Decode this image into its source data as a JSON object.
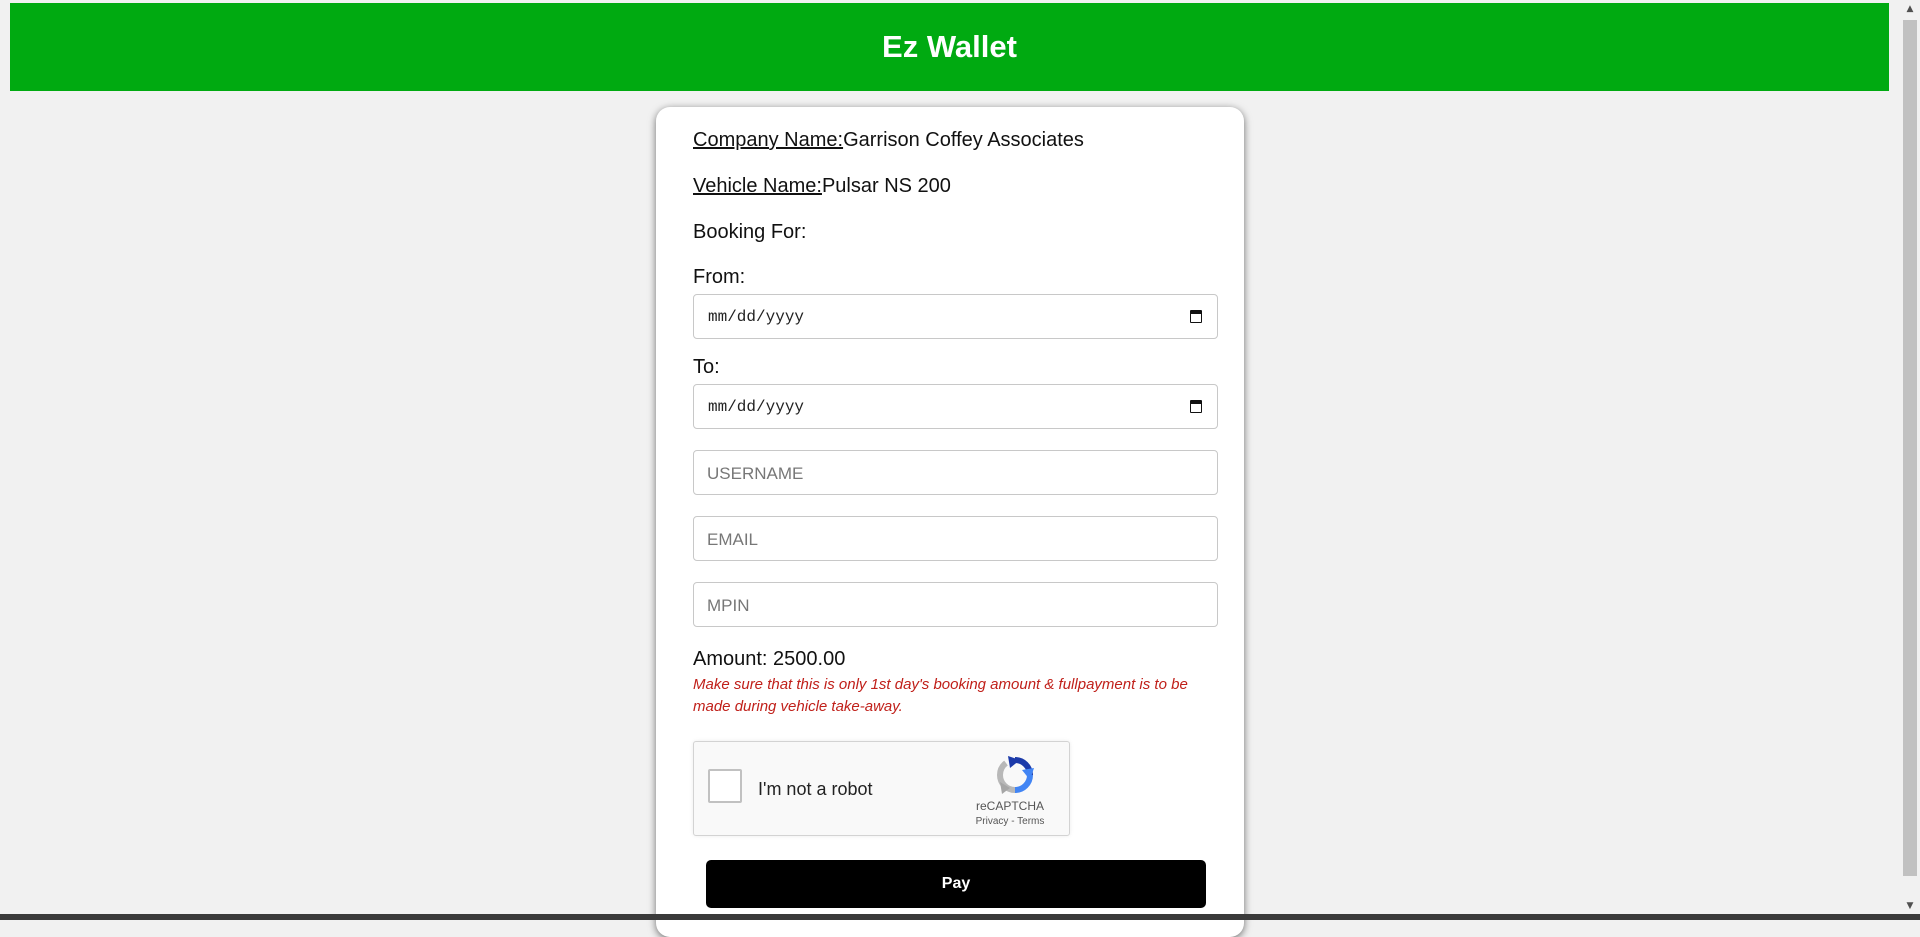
{
  "header": {
    "title": "Ez Wallet"
  },
  "booking": {
    "company_label": "Company Name:",
    "company_value": "Garrison Coffey Associates",
    "vehicle_label": "Vehicle Name:",
    "vehicle_value": "Pulsar NS 200",
    "booking_for_label": "Booking For:"
  },
  "form": {
    "from_label": "From:",
    "from_value": "mm/dd/yyyy",
    "to_label": "To:",
    "to_value": "mm/dd/yyyy",
    "username_placeholder": "USERNAME",
    "email_placeholder": "EMAIL",
    "mpin_placeholder": "MPIN"
  },
  "amount": {
    "label": "Amount:",
    "value": "2500.00",
    "note": "Make sure that this is only 1st day's booking amount & fullpayment is to be made during vehicle take-away."
  },
  "recaptcha": {
    "label": "I'm not a robot",
    "brand": "reCAPTCHA",
    "privacy": "Privacy",
    "separator": " - ",
    "terms": "Terms",
    "checked": false
  },
  "pay_button": {
    "label": "Pay"
  },
  "colors": {
    "header_bg": "#00aa11",
    "note_text": "#c0201a",
    "button_bg": "#000000"
  },
  "icons": [
    "calendar-icon",
    "recaptcha-logo-icon",
    "scroll-up-arrow-icon",
    "scroll-down-arrow-icon"
  ]
}
